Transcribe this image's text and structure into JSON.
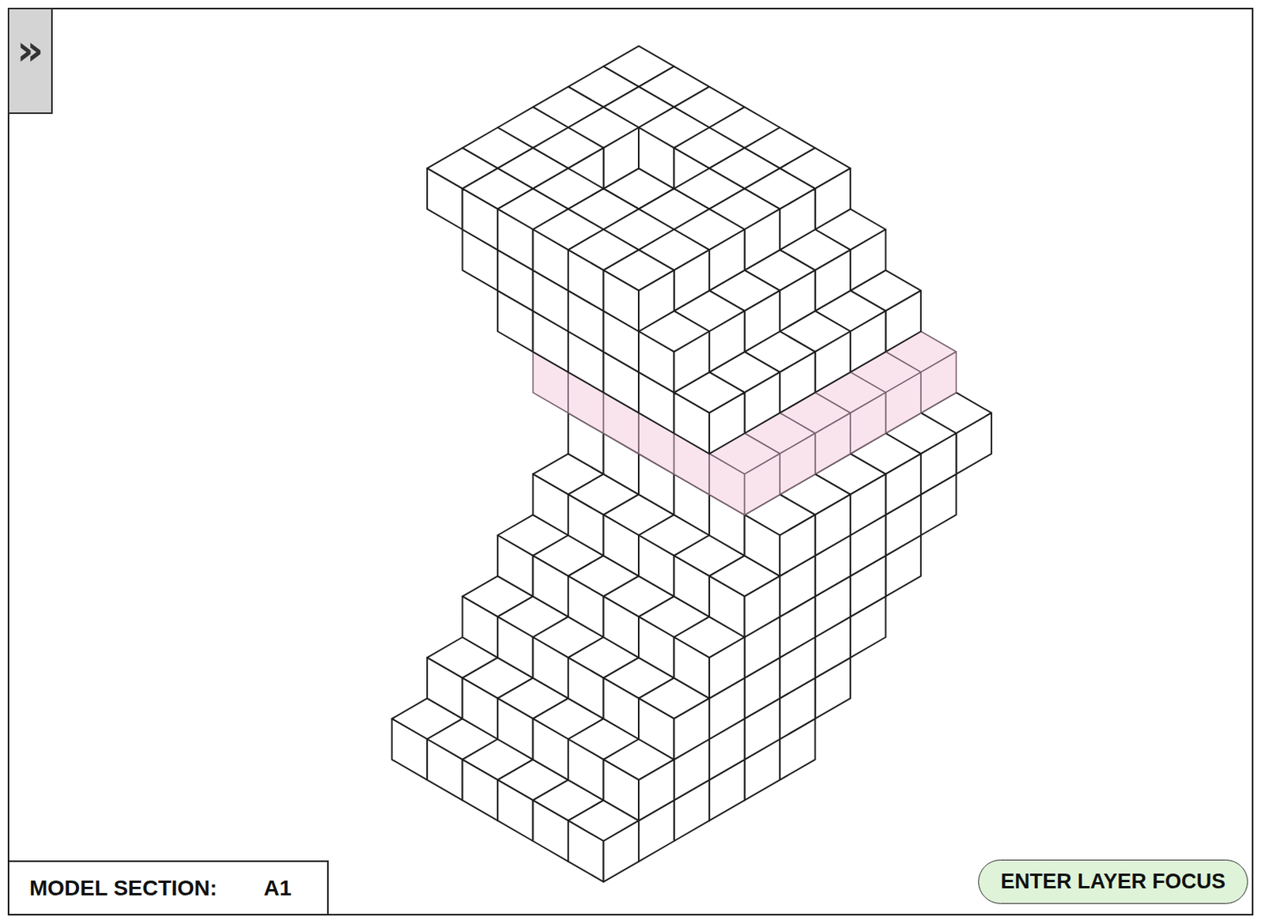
{
  "sidebar_toggle": {
    "label": "»"
  },
  "model": {
    "section_label": "MODEL SECTION:",
    "section": "A1",
    "layers": [
      {
        "offset": [
          0,
          0
        ],
        "size": [
          6,
          6
        ],
        "holes": [],
        "selected": false
      },
      {
        "offset": [
          1,
          0
        ],
        "size": [
          6,
          6
        ],
        "holes": [],
        "selected": false
      },
      {
        "offset": [
          2,
          0
        ],
        "size": [
          6,
          6
        ],
        "holes": [],
        "selected": false
      },
      {
        "offset": [
          3,
          0
        ],
        "size": [
          6,
          6
        ],
        "holes": [],
        "selected": false
      },
      {
        "offset": [
          4,
          0
        ],
        "size": [
          6,
          6
        ],
        "holes": [],
        "selected": false
      },
      {
        "offset": [
          5,
          0
        ],
        "size": [
          6,
          6
        ],
        "holes": [],
        "selected": false
      },
      {
        "offset": [
          5,
          1
        ],
        "size": [
          6,
          6
        ],
        "holes": [],
        "selected": true
      },
      {
        "offset": [
          5,
          2
        ],
        "size": [
          6,
          6
        ],
        "holes": [],
        "selected": false
      },
      {
        "offset": [
          5,
          3
        ],
        "size": [
          6,
          6
        ],
        "holes": [],
        "selected": false
      },
      {
        "offset": [
          5,
          4
        ],
        "size": [
          6,
          6
        ],
        "holes": [
          [
            2,
            2
          ],
          [
            3,
            2
          ],
          [
            2,
            3
          ],
          [
            3,
            3
          ]
        ],
        "selected": false
      }
    ]
  },
  "layer_focus_button": {
    "label": "ENTER LAYER FOCUS"
  }
}
